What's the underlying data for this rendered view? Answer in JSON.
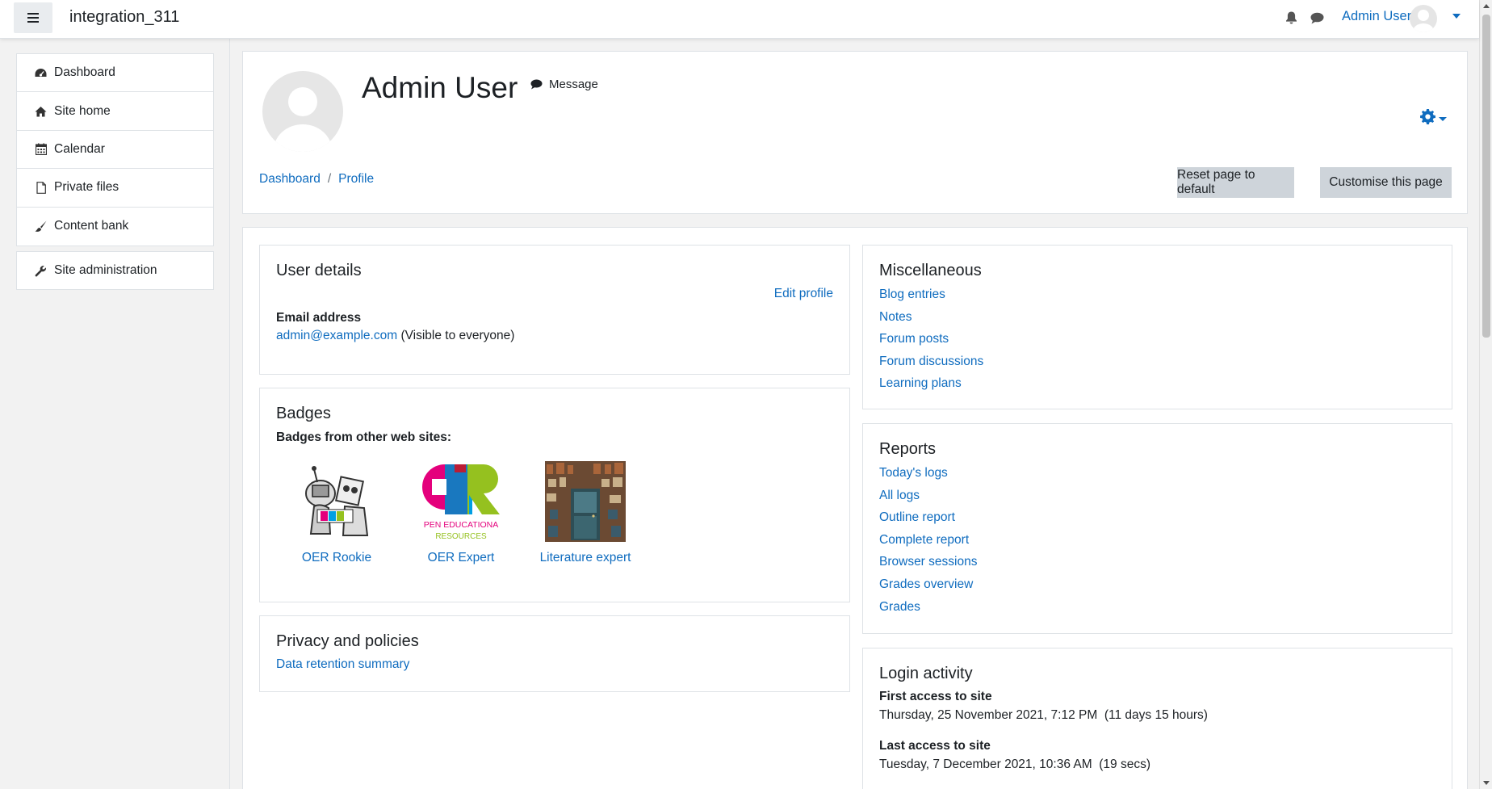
{
  "navbar": {
    "site_name": "integration_311",
    "user_name": "Admin User"
  },
  "drawer": {
    "items": [
      {
        "label": "Dashboard",
        "icon": "dashboard-icon"
      },
      {
        "label": "Site home",
        "icon": "home-icon"
      },
      {
        "label": "Calendar",
        "icon": "calendar-icon"
      },
      {
        "label": "Private files",
        "icon": "file-icon"
      },
      {
        "label": "Content bank",
        "icon": "brush-icon"
      }
    ],
    "admin": {
      "label": "Site administration",
      "icon": "wrench-icon"
    }
  },
  "header": {
    "title": "Admin User",
    "message_label": "Message",
    "breadcrumb": [
      "Dashboard",
      "Profile"
    ],
    "reset_label": "Reset page to default",
    "customise_label": "Customise this page"
  },
  "user_details": {
    "title": "User details",
    "edit_label": "Edit profile",
    "email_label": "Email address",
    "email": "admin@example.com",
    "visibility": "(Visible to everyone)"
  },
  "badges": {
    "title": "Badges",
    "subtitle": "Badges from other web sites:",
    "items": [
      {
        "name": "OER Rookie"
      },
      {
        "name": "OER Expert"
      },
      {
        "name": "Literature expert"
      }
    ],
    "oer_expert_text": [
      "PEN EDUCATIONA",
      "RESOURCES"
    ]
  },
  "privacy": {
    "title": "Privacy and policies",
    "link": "Data retention summary"
  },
  "misc": {
    "title": "Miscellaneous",
    "links": [
      "Blog entries",
      "Notes",
      "Forum posts",
      "Forum discussions",
      "Learning plans"
    ]
  },
  "reports": {
    "title": "Reports",
    "links": [
      "Today's logs",
      "All logs",
      "Outline report",
      "Complete report",
      "Browser sessions",
      "Grades overview",
      "Grades"
    ]
  },
  "login": {
    "title": "Login activity",
    "first_label": "First access to site",
    "first_value": "Thursday, 25 November 2021, 7:12 PM  (11 days 15 hours)",
    "last_label": "Last access to site",
    "last_value": "Tuesday, 7 December 2021, 10:36 AM  (19 secs)"
  },
  "colors": {
    "link": "#0f6cbf",
    "text": "#1d2125",
    "button_bg": "#ced4da",
    "page_bg": "#f2f2f2"
  }
}
